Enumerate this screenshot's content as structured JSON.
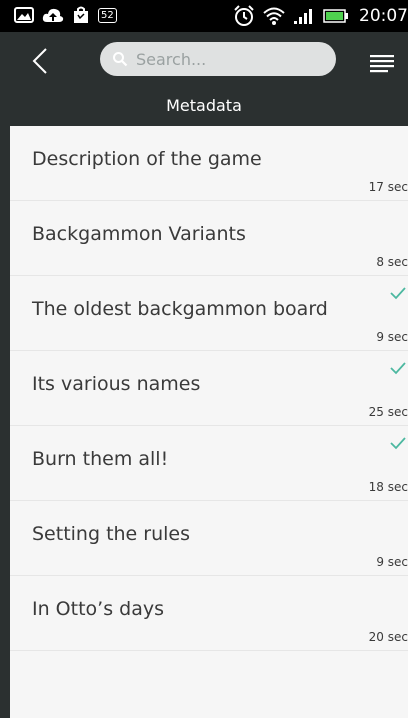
{
  "status_bar": {
    "time": "20:07",
    "badge": "52"
  },
  "toolbar": {
    "search_placeholder": "Search..."
  },
  "page_title": "Metadata",
  "colors": {
    "toolbar_bg": "#2b3030",
    "check": "#4cb8a0",
    "list_bg": "#f6f6f6"
  },
  "items": [
    {
      "title": "Description of the game",
      "duration": "17 sec",
      "checked": false
    },
    {
      "title": "Backgammon Variants",
      "duration": "8 sec",
      "checked": false
    },
    {
      "title": "The oldest backgammon board",
      "duration": "9 sec",
      "checked": true
    },
    {
      "title": "Its various names",
      "duration": "25 sec",
      "checked": true
    },
    {
      "title": "Burn them all!",
      "duration": "18 sec",
      "checked": true
    },
    {
      "title": "Setting the rules",
      "duration": "9 sec",
      "checked": false
    },
    {
      "title": "In Otto’s days",
      "duration": "20 sec",
      "checked": false
    }
  ]
}
